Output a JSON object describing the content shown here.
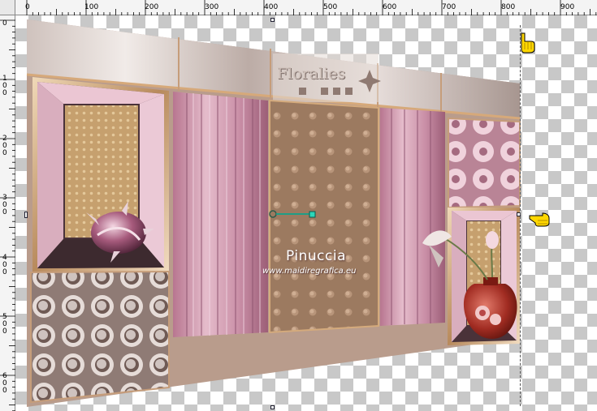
{
  "ruler": {
    "top_labels": [
      "0",
      "100",
      "200",
      "300",
      "400",
      "500",
      "600",
      "700",
      "800",
      "900"
    ],
    "left_labels": [
      "0",
      "1\n0\n0",
      "2\n0\n0",
      "3\n0\n0",
      "4\n0\n0",
      "5\n0\n0",
      "6\n0\n0"
    ]
  },
  "artwork": {
    "banner_text": "Floralies",
    "watermark": "Pinuccia",
    "watermark_url": "www.maidiregrafica.eu"
  },
  "colors": {
    "pink": "#c98ea6",
    "rose": "#e0b9c8",
    "brown": "#a07a5a",
    "tan": "#c8a06e",
    "frame": "#d9b48a",
    "plum": "#4a3239",
    "teal_handle": "#2bd6b8",
    "checker": "#c8c8c8"
  },
  "icons": {
    "pointer_hand_top": "hand-pointer-icon",
    "pointer_hand_right": "hand-pointing-left-icon",
    "rotation_handle": "rotate-handle-icon"
  }
}
